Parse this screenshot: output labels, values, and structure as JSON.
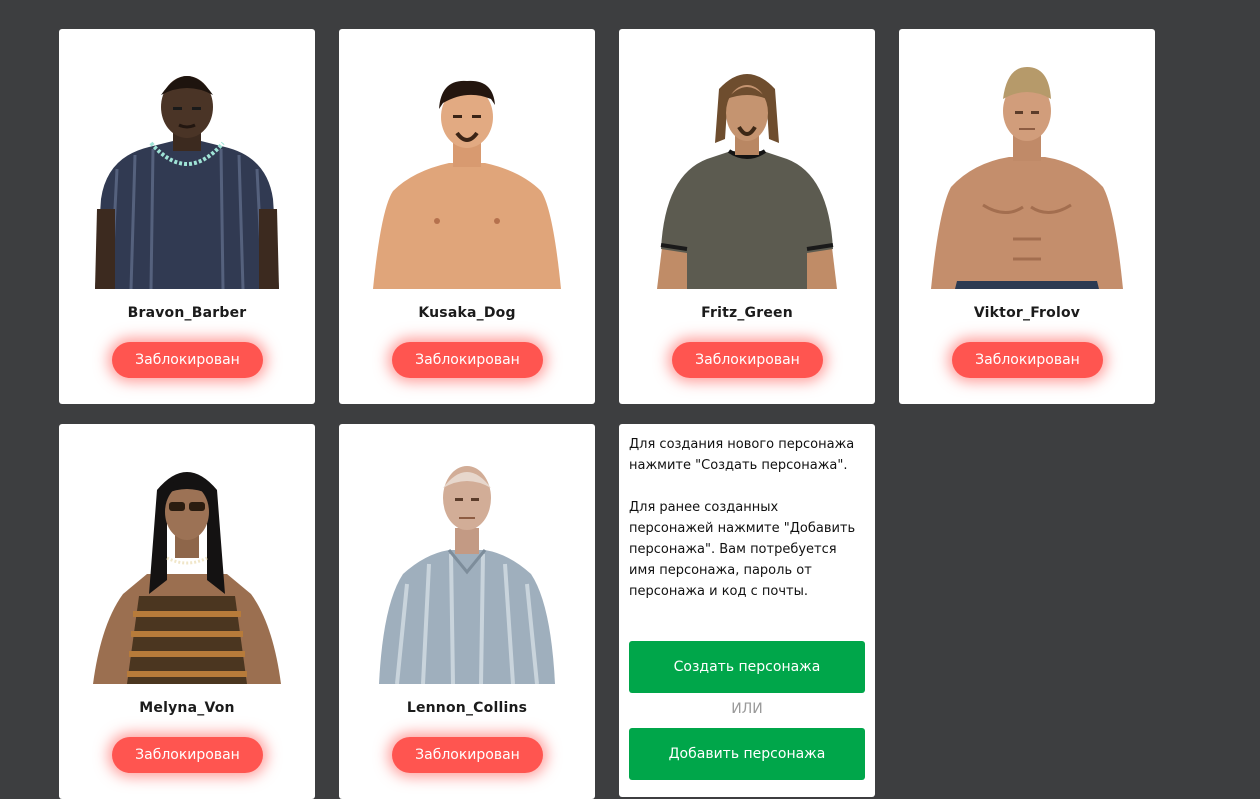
{
  "characters": [
    {
      "name": "Bravon_Barber",
      "status": "Заблокирован",
      "portrait": "bald-man-striped-shirt-chain"
    },
    {
      "name": "Kusaka_Dog",
      "status": "Заблокирован",
      "portrait": "shirtless-man-goatee"
    },
    {
      "name": "Fritz_Green",
      "status": "Заблокирован",
      "portrait": "long-hair-man-olive-shirt"
    },
    {
      "name": "Viktor_Frolov",
      "status": "Заблокирован",
      "portrait": "shirtless-man-blond-hair"
    },
    {
      "name": "Melyna_Von",
      "status": "Заблокирован",
      "portrait": "woman-sunglasses-striped-top"
    },
    {
      "name": "Lennon_Collins",
      "status": "Заблокирован",
      "portrait": "old-man-grey-shirt"
    }
  ],
  "info": {
    "paragraph1": "Для создания нового персонажа нажмите \"Создать персонажа\".",
    "paragraph2": "Для ранее созданных персонажей нажмите \"Добавить персонажа\". Вам потребуется имя персонажа, пароль от персонажа и код с почты.",
    "create_label": "Создать персонажа",
    "or_label": "ИЛИ",
    "add_label": "Добавить персонажа"
  },
  "colors": {
    "background": "#3d3e40",
    "card": "#ffffff",
    "blocked_button": "#ff5550",
    "primary_button": "#00a64a"
  }
}
